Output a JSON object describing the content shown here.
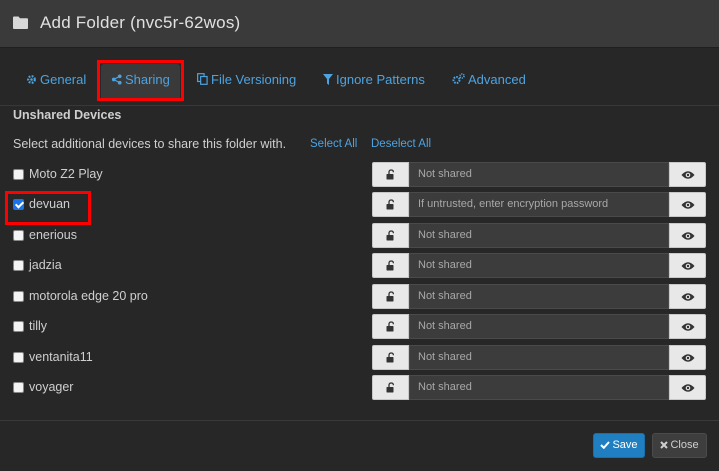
{
  "dialog": {
    "title": "Add Folder (nvc5r-62wos)",
    "icon": "folder-icon"
  },
  "tabs": [
    {
      "label": "General",
      "icon": "gear-icon"
    },
    {
      "label": "Sharing",
      "icon": "share-icon",
      "active": true
    },
    {
      "label": "File Versioning",
      "icon": "copy-icon"
    },
    {
      "label": "Ignore Patterns",
      "icon": "filter-icon"
    },
    {
      "label": "Advanced",
      "icon": "gears-icon"
    }
  ],
  "sharing": {
    "section_title": "Unshared Devices",
    "instructions": "Select additional devices to share this folder with.",
    "select_all": "Select All",
    "deselect_all": "Deselect All",
    "devices": [
      {
        "name": "Moto Z2 Play",
        "checked": false,
        "password_placeholder": "Not shared"
      },
      {
        "name": "devuan",
        "checked": true,
        "password_placeholder": "If untrusted, enter encryption password"
      },
      {
        "name": "enerious",
        "checked": false,
        "password_placeholder": "Not shared"
      },
      {
        "name": "jadzia",
        "checked": false,
        "password_placeholder": "Not shared"
      },
      {
        "name": "motorola edge 20 pro",
        "checked": false,
        "password_placeholder": "Not shared"
      },
      {
        "name": "tilly",
        "checked": false,
        "password_placeholder": "Not shared"
      },
      {
        "name": "ventanita11",
        "checked": false,
        "password_placeholder": "Not shared"
      },
      {
        "name": "voyager",
        "checked": false,
        "password_placeholder": "Not shared"
      }
    ]
  },
  "footer": {
    "save_label": "Save",
    "close_label": "Close"
  },
  "colors": {
    "accent": "#4da3e0",
    "primary_button": "#1f7fc1",
    "highlight": "#ff0000",
    "background": "#272727"
  }
}
